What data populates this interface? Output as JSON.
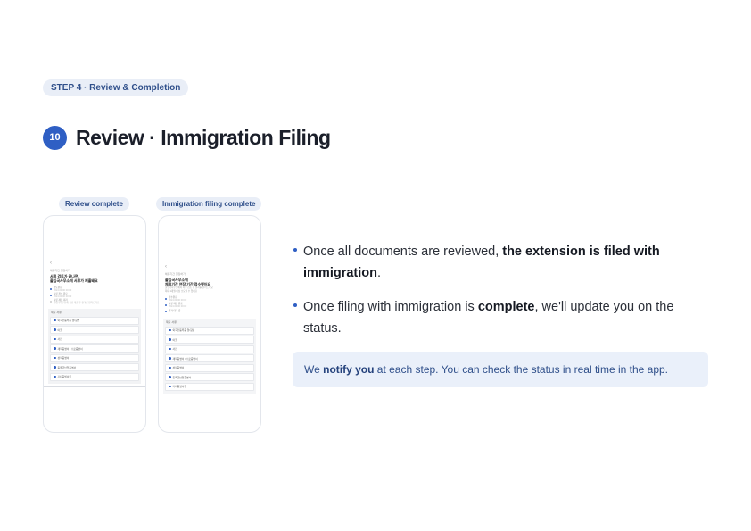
{
  "header": {
    "step_label": "STEP 4 · Review & Completion",
    "step_number": "10",
    "title": "Review · Immigration Filing"
  },
  "phones": [
    {
      "label": "Review complete",
      "screen": {
        "back": "‹",
        "caption": "체류기간 연장허가",
        "title_1": "서류 검토가 끝나면,",
        "title_2": "출입국사무소에 서류가 제출돼요",
        "timeline": [
          {
            "text": "검토완료",
            "date": "2024.00.00 00:00"
          },
          {
            "text": "서류 접수 완료",
            "date": "2024.00.00 00:00"
          },
          {
            "text": "서류 제출 대기",
            "date": "출입국사무소에 서류 제출 후 결과를 알려드려요"
          }
        ],
        "docs_header": "제출 서류",
        "docs": [
          "외국인등록증 앞/뒷면",
          "여권",
          "사진",
          "재학증명서 / 수료증명서",
          "성적증명서",
          "등록금납입증명서",
          "기타증빙서류"
        ]
      }
    },
    {
      "label": "Immigration filing complete",
      "screen": {
        "back": "‹",
        "caption": "체류기간 연장허가",
        "title_1": "출입국사무소에",
        "title_2": "체류기간 연장 기간 접수됐어요",
        "subtitle_1": "출입국사무소에서 서류 검토 후 결과를 알려드려요",
        "subtitle_2": "최대 1개월 이상 소요될 수 있어요",
        "timeline": [
          {
            "text": "접수완료",
            "date": "2024.00.00 00:00"
          },
          {
            "text": "서류 제출 완료",
            "date": "2024.00.00 00:00"
          },
          {
            "text": "결과 대기 중",
            "date": ""
          }
        ],
        "docs_header": "제출 서류",
        "docs": [
          "외국인등록증 앞/뒷면",
          "여권",
          "사진",
          "재학증명서 / 수료증명서",
          "성적증명서",
          "등록금납입증명서",
          "기타증빙서류"
        ]
      }
    }
  ],
  "bullets": [
    {
      "pre": "Once all documents are reviewed, ",
      "bold": "the extension is filed with immigration",
      "post": "."
    },
    {
      "pre": "Once filing with immigration is ",
      "bold": "complete",
      "post": ", we'll update you on the status."
    }
  ],
  "notice": {
    "pre": "We ",
    "bold": "notify you",
    "post": " at each step. You can check the status in real time in the app."
  },
  "colors": {
    "accent": "#2f5fc4",
    "pill_bg": "#e9eef7",
    "notice_bg": "#eaf0fa"
  }
}
